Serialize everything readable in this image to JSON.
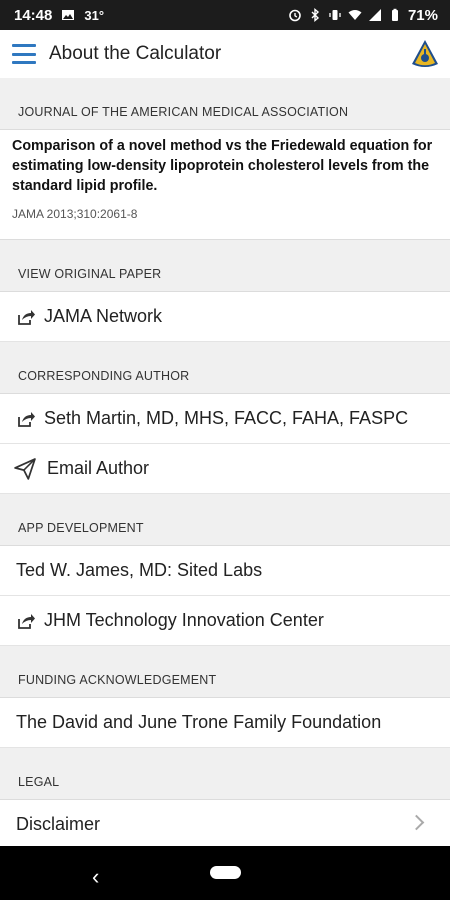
{
  "status_bar": {
    "time": "14:48",
    "temperature": "31°",
    "battery": "71%"
  },
  "app_bar": {
    "title": "About the Calculator"
  },
  "sections": {
    "journal": {
      "header": "JOURNAL OF THE AMERICAN MEDICAL ASSOCIATION",
      "paper_title": "Comparison of a novel method vs the Friedewald equation for estimating low-density lipoprotein cholesterol levels from the standard lipid profile.",
      "citation": "JAMA 2013;310:2061-8"
    },
    "original_paper": {
      "header": "VIEW ORIGINAL PAPER",
      "link": "JAMA Network"
    },
    "author": {
      "header": "CORRESPONDING AUTHOR",
      "name": "Seth Martin, MD, MHS, FACC, FAHA, FASPC",
      "email_label": "Email Author"
    },
    "app_development": {
      "header": "APP DEVELOPMENT",
      "developer": "Ted W. James, MD: Sited Labs",
      "center": "JHM Technology Innovation Center"
    },
    "funding": {
      "header": "FUNDING ACKNOWLEDGEMENT",
      "foundation": "The David and June Trone Family Foundation"
    },
    "legal": {
      "header": "LEGAL",
      "disclaimer": "Disclaimer"
    }
  },
  "icons": {
    "menu": "hamburger-menu-icon",
    "logo": "jhm-shield-logo",
    "external_link": "external-link-icon",
    "email": "paper-plane-icon",
    "chevron": "chevron-right-icon"
  },
  "colors": {
    "accent": "#2f78c0",
    "background": "#f0f0f0"
  }
}
